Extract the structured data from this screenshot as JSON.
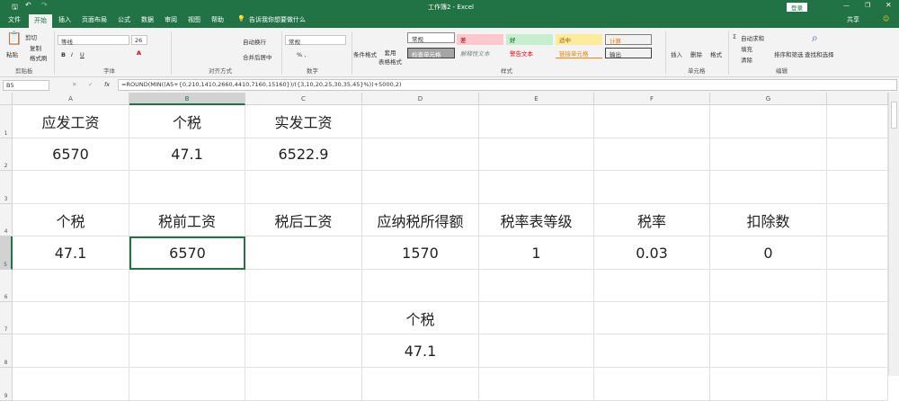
{
  "title": "工作簿2 - Excel",
  "login": "登录",
  "share": "共享",
  "tabs": [
    "文件",
    "开始",
    "插入",
    "页面布局",
    "公式",
    "数据",
    "审阅",
    "视图",
    "帮助"
  ],
  "tellme": "告诉我你想要做什么",
  "ribbon": {
    "paste": "粘贴",
    "cut": "剪切",
    "copy": "复制",
    "format_painter": "格式刷",
    "clipboard": "剪贴板",
    "font_name": "等线",
    "font_size": "26",
    "font": "字体",
    "wrap": "自动换行",
    "merge": "合并后居中",
    "alignment": "对齐方式",
    "number_format": "常规",
    "number": "数字",
    "cond_format": "条件格式",
    "table_format": "套用\n表格格式",
    "styles": [
      "常规",
      "差",
      "好",
      "适中",
      "计算",
      "检查单元格",
      "解释性文本",
      "警告文本",
      "链接单元格",
      "输出"
    ],
    "styles_group": "样式",
    "insert": "插入",
    "delete": "删除",
    "format": "格式",
    "cells": "单元格",
    "autosum": "自动求和",
    "fill": "填充",
    "clear": "清除",
    "sort": "排序和筛选",
    "find": "查找和选择",
    "editing": "编辑"
  },
  "namebox": "B5",
  "formula": "=ROUND(MIN((A5+{0,210,1410,2660,4410,7160,15160})/({3,10,20,25,30,35,45}%))+5000,2)",
  "columns": [
    "A",
    "B",
    "C",
    "D",
    "E",
    "F",
    "G"
  ],
  "rows": [
    [
      "应发工资",
      "个税",
      "实发工资",
      "",
      "",
      "",
      ""
    ],
    [
      "6570",
      "47.1",
      "6522.9",
      "",
      "",
      "",
      ""
    ],
    [
      "",
      "",
      "",
      "",
      "",
      "",
      ""
    ],
    [
      "个税",
      "税前工资",
      "税后工资",
      "应纳税所得额",
      "税率表等级",
      "税率",
      "扣除数"
    ],
    [
      "47.1",
      "6570",
      "",
      "1570",
      "1",
      "0.03",
      "0"
    ],
    [
      "",
      "",
      "",
      "",
      "",
      "",
      ""
    ],
    [
      "",
      "",
      "",
      "个税",
      "",
      "",
      ""
    ],
    [
      "",
      "",
      "",
      "47.1",
      "",
      "",
      ""
    ],
    [
      "",
      "",
      "",
      "",
      "",
      "",
      ""
    ]
  ],
  "row_numbers": [
    "1",
    "2",
    "3",
    "4",
    "5",
    "6",
    "7",
    "8",
    "9"
  ]
}
